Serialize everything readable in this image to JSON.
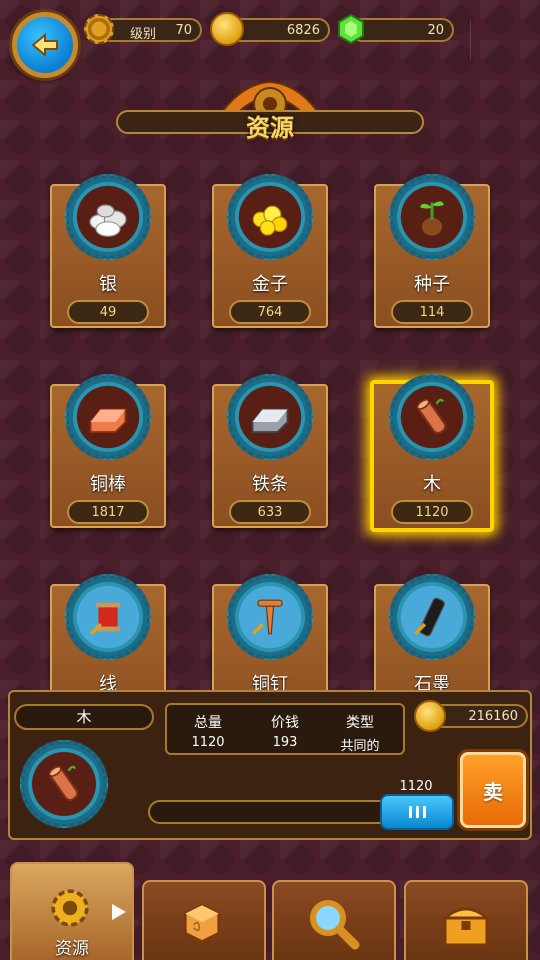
{
  "hud": {
    "level_label": "级别",
    "level_value": "70",
    "coins": "6826",
    "gems": "20"
  },
  "title": "资源",
  "resources": [
    {
      "label": "银",
      "count": "49",
      "icon": "silver-ore-icon"
    },
    {
      "label": "金子",
      "count": "764",
      "icon": "gold-nuggets-icon"
    },
    {
      "label": "种子",
      "count": "114",
      "icon": "seed-sprout-icon"
    },
    {
      "label": "铜棒",
      "count": "1817",
      "icon": "copper-bar-icon"
    },
    {
      "label": "铁条",
      "count": "633",
      "icon": "iron-bar-icon"
    },
    {
      "label": "木",
      "count": "1120",
      "icon": "wood-log-icon",
      "selected": true
    },
    {
      "label": "线",
      "count": "",
      "icon": "thread-spool-icon"
    },
    {
      "label": "铜钉",
      "count": "",
      "icon": "copper-nail-icon"
    },
    {
      "label": "石墨",
      "count": "",
      "icon": "graphite-rod-icon"
    }
  ],
  "detail": {
    "name": "木",
    "headers": {
      "total": "总量",
      "price": "价钱",
      "type": "类型"
    },
    "values": {
      "total": "1120",
      "price": "193",
      "type": "共同的"
    },
    "sell_total": "216160",
    "slider_value": "1120",
    "slider_fraction": 1.0,
    "sell_label": "卖"
  },
  "tabs": [
    {
      "label": "资源",
      "icon": "gear-icon",
      "active": true
    },
    {
      "label": "",
      "icon": "dice-icon"
    },
    {
      "label": "",
      "icon": "magnifier-icon"
    },
    {
      "label": "",
      "icon": "treasure-chest-icon"
    }
  ],
  "colors": {
    "accent_gold": "#f7d66a",
    "selected_glow": "#ffd400",
    "sell_orange": "#e86a06",
    "action_blue": "#0a86cf"
  }
}
